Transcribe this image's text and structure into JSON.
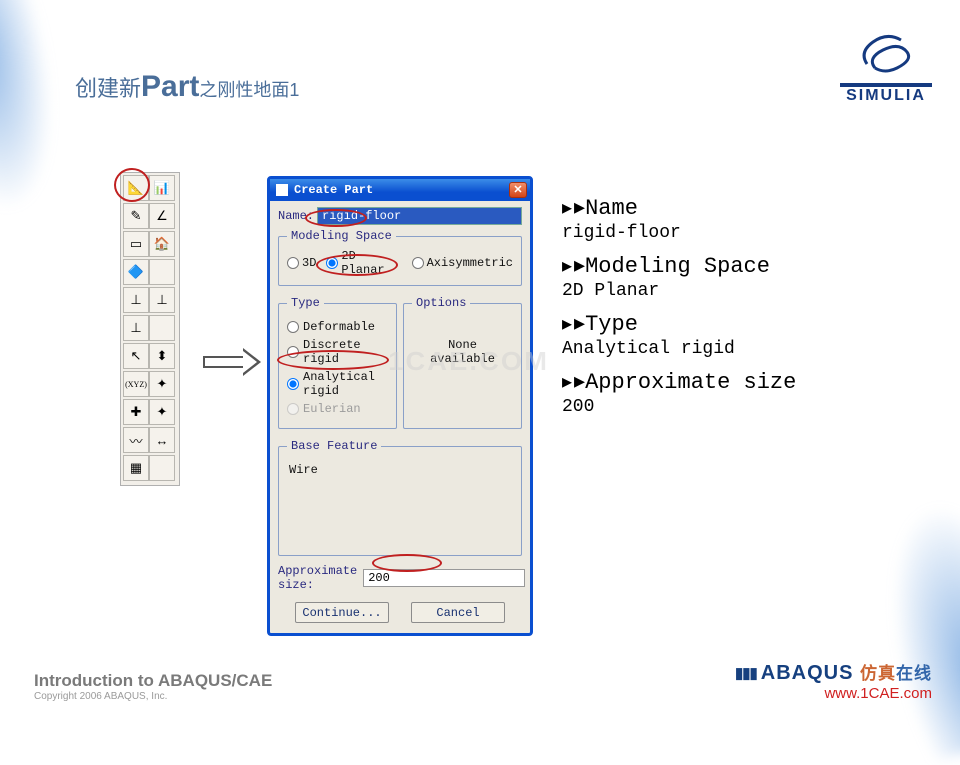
{
  "slide_title": {
    "prefix": "创建新",
    "accent": "Part",
    "suffix": "之刚性地面1"
  },
  "logo": {
    "ds": "DS",
    "name": "SIMULIA"
  },
  "dialog": {
    "title": "Create Part",
    "name_label": "Name:",
    "name_value": "rigid-floor",
    "modeling_space": {
      "legend": "Modeling Space",
      "opts": {
        "a": "3D",
        "b": "2D Planar",
        "c": "Axisymmetric"
      }
    },
    "type": {
      "legend": "Type",
      "opts": {
        "a": "Deformable",
        "b": "Discrete rigid",
        "c": "Analytical rigid",
        "d": "Eulerian"
      }
    },
    "options": {
      "legend": "Options",
      "body": "None available"
    },
    "base": {
      "legend": "Base Feature",
      "body": "Wire"
    },
    "approx_label": "Approximate size:",
    "approx_value": "200",
    "continue_btn": "Continue...",
    "cancel_btn": "Cancel"
  },
  "summary": {
    "h1": "Name",
    "v1": "rigid-floor",
    "h2": "Modeling Space",
    "v2": "2D Planar",
    "h3": "Type",
    "v3": "Analytical rigid",
    "h4": "Approximate size",
    "v4": "200"
  },
  "footer": {
    "t1": "Introduction to ABAQUS/CAE",
    "t2": "Copyright 2006 ABAQUS, Inc.",
    "brand": "ABAQUS",
    "cn1": "仿真",
    "cn2": "在线",
    "url": "www.1CAE.com"
  },
  "watermark": "1CAE.COM",
  "toolbar_icons": [
    [
      "📐",
      "📊"
    ],
    [
      "✎",
      "∠"
    ],
    [
      "▭",
      "🏠"
    ],
    [
      "🔷",
      "　"
    ],
    [
      "⊥",
      "⊥"
    ],
    [
      "⊥",
      "　"
    ],
    [
      "↖",
      "⬍"
    ],
    [
      "(XYZ)",
      "✦"
    ],
    [
      "✚",
      "✦"
    ],
    [
      "〰",
      "↔"
    ],
    [
      "▦",
      "　"
    ]
  ]
}
